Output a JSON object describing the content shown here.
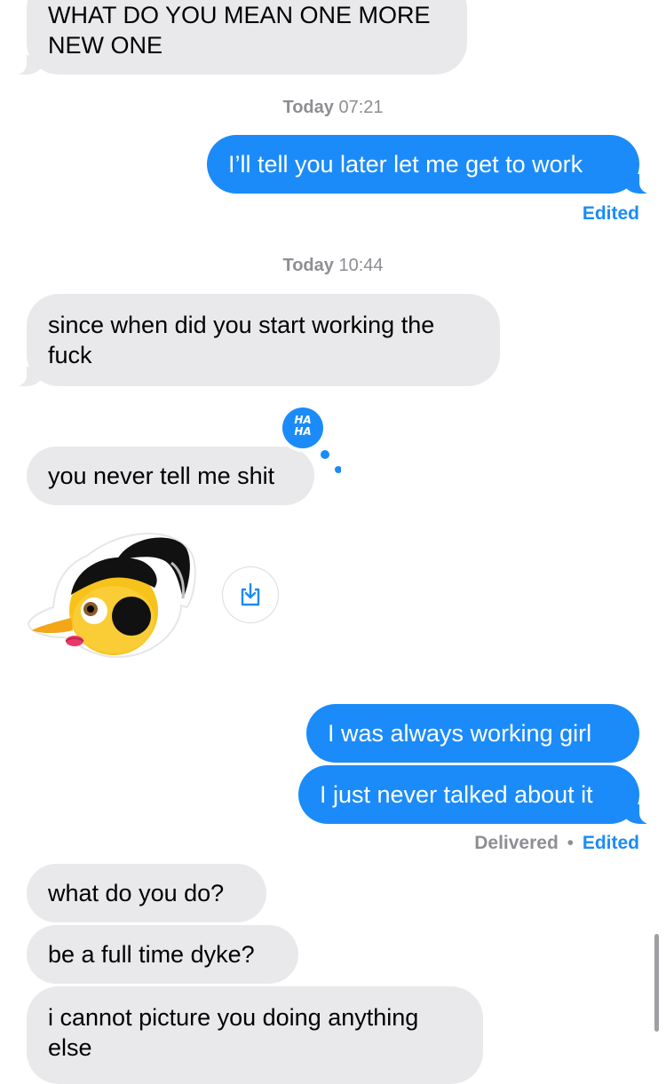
{
  "messages": {
    "m1": "WHAT DO YOU MEAN ONE MORE NEW ONE",
    "m2": "I’ll tell you later let me get to work",
    "m3": "since when did you start working the fuck",
    "m4": "you never tell me shit",
    "m5": "I was always working girl",
    "m6": "I just never talked about it",
    "m7": "what do you do?",
    "m8": "be a full time dyke?",
    "m9": "i cannot picture you doing anything else"
  },
  "timestamps": {
    "t1_day": "Today",
    "t1_time": "07:21",
    "t2_day": "Today",
    "t2_time": "10:44"
  },
  "status": {
    "edited": "Edited",
    "delivered": "Delivered",
    "separator": "•"
  },
  "tapback": {
    "reaction": "HA HA",
    "line1": "HA",
    "line2": "HA"
  },
  "icons": {
    "tapback": "haha-tapback-icon",
    "sticker": "memoji-sticker",
    "save": "save-download-icon"
  },
  "colors": {
    "outgoing": "#1b8bf9",
    "incoming": "#e9e9eb",
    "timestamp": "#8e8e93",
    "edited": "#1b8bf9"
  }
}
